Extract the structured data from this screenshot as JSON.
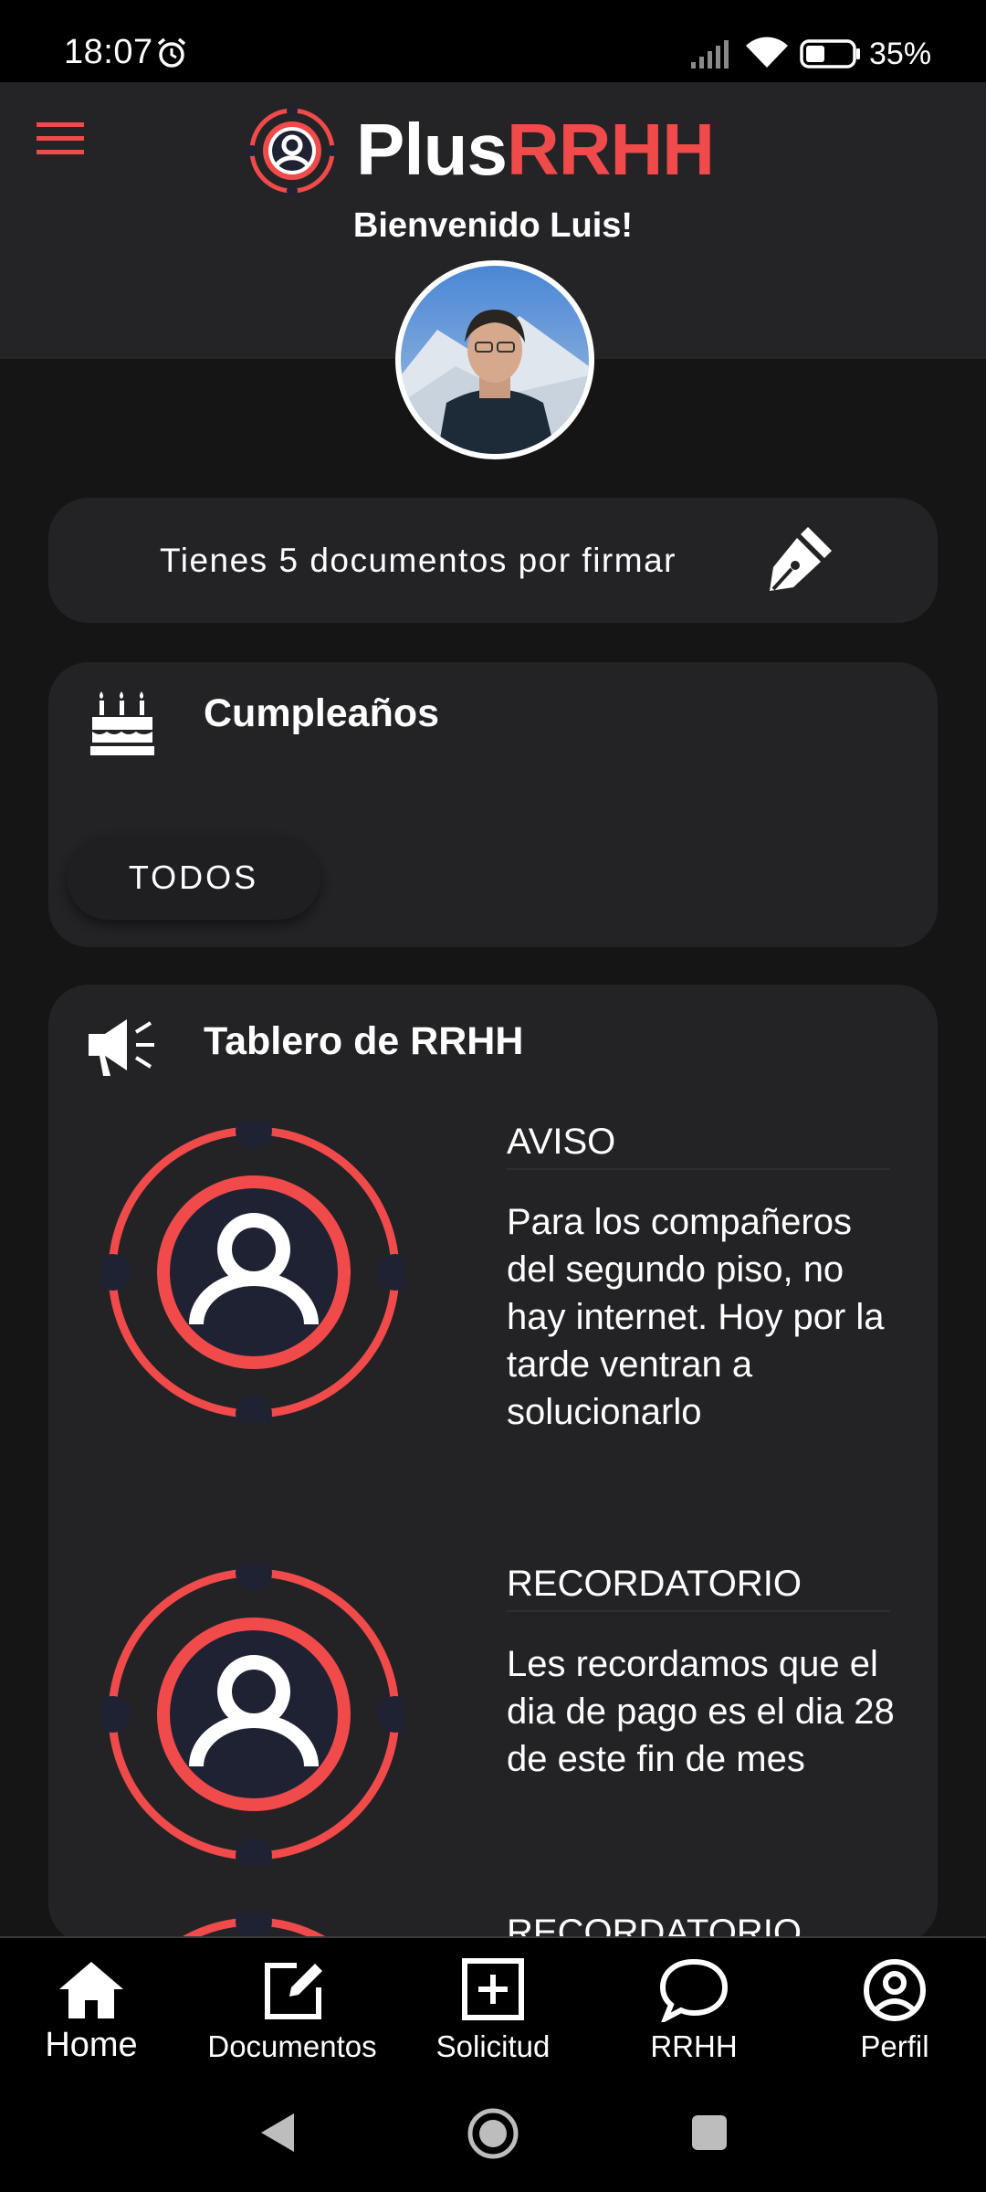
{
  "status_bar": {
    "time": "18:07",
    "battery": "35%"
  },
  "header": {
    "brand_plus": "Plus",
    "brand_rrhh": "RRHH",
    "welcome": "Bienvenido Luis!"
  },
  "sign_banner": {
    "text": "Tienes 5 documentos por firmar"
  },
  "birthdays": {
    "title": "Cumpleaños",
    "all_button": "TODOS"
  },
  "board": {
    "title": "Tablero de RRHH",
    "notices": [
      {
        "type": "AVISO",
        "body": "Para los compañeros del segundo piso, no hay internet. Hoy por la tarde ventran a solucionarlo"
      },
      {
        "type": "RECORDATORIO",
        "body": "Les recordamos que el dia de pago es el dia 28 de este fin de mes"
      },
      {
        "type": "RECORDATORIO",
        "body": ""
      }
    ]
  },
  "bottom_nav": [
    {
      "label": "Home",
      "icon": "home-icon",
      "active": true
    },
    {
      "label": "Documentos",
      "icon": "edit-document-icon",
      "active": false
    },
    {
      "label": "Solicitud",
      "icon": "add-box-icon",
      "active": false
    },
    {
      "label": "RRHH",
      "icon": "chat-bubble-icon",
      "active": false
    },
    {
      "label": "Perfil",
      "icon": "profile-icon",
      "active": false
    }
  ],
  "colors": {
    "accent": "#f04a4a",
    "background": "#151515",
    "surface": "#232326",
    "header": "#242427"
  }
}
